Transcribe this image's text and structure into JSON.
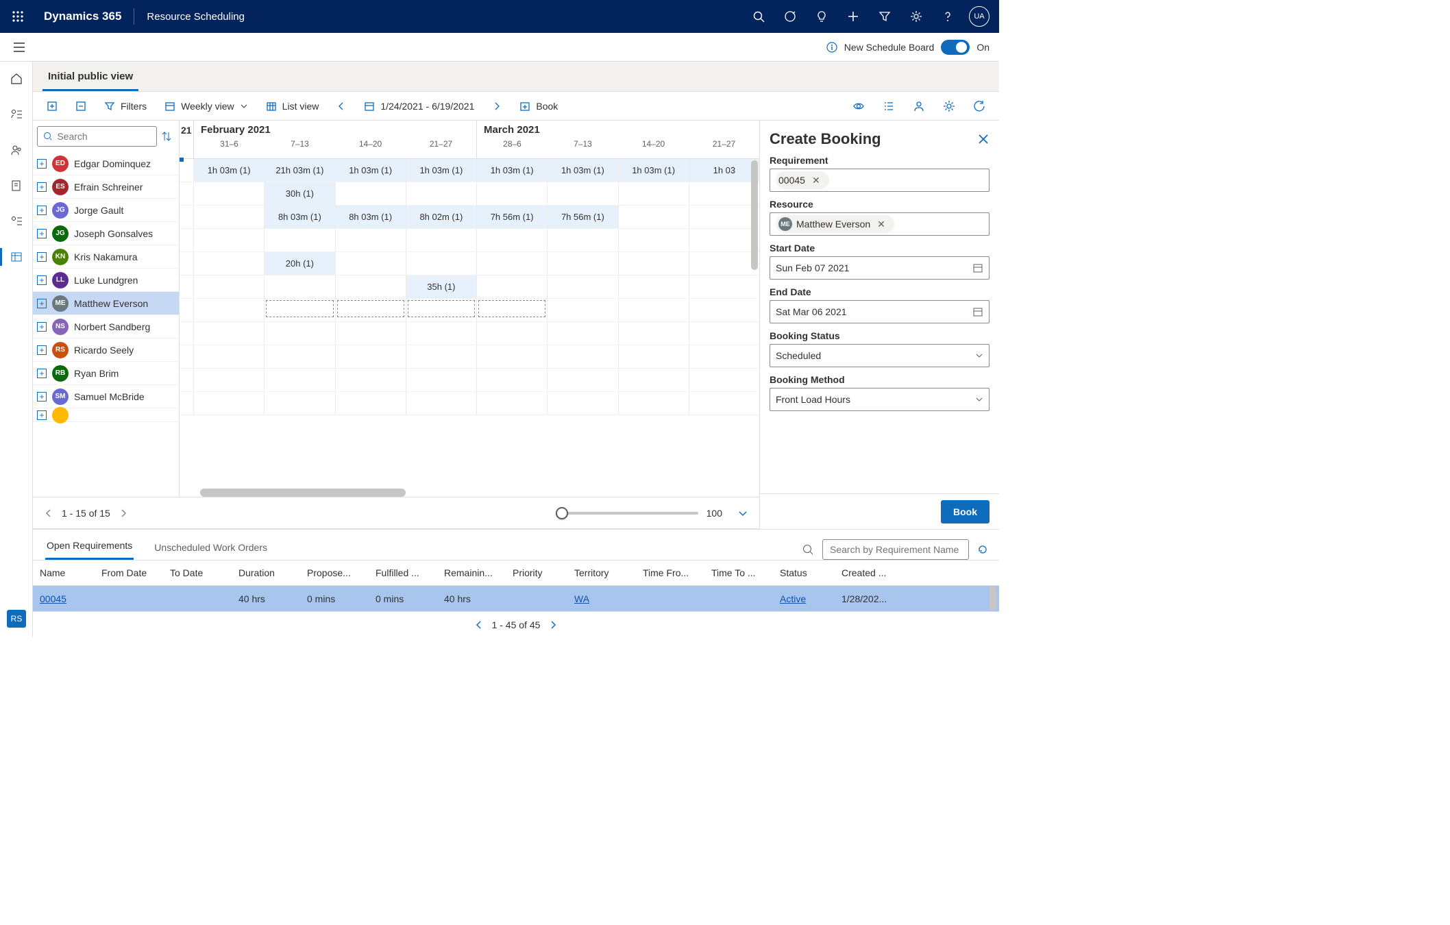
{
  "topbar": {
    "brand": "Dynamics 365",
    "app": "Resource Scheduling",
    "avatar": "UA",
    "icons": [
      "search-icon",
      "target-icon",
      "lightbulb-icon",
      "plus-icon",
      "filter-icon",
      "settings-icon",
      "help-icon"
    ]
  },
  "secondary": {
    "new_board": "New Schedule Board",
    "toggle_state": "On"
  },
  "tabs": {
    "active": "Initial public view"
  },
  "toolbar": {
    "filters": "Filters",
    "viewmode": "Weekly view",
    "listview": "List view",
    "daterange": "1/24/2021 - 6/19/2021",
    "book": "Book"
  },
  "search": {
    "placeholder": "Search"
  },
  "resources": [
    {
      "initials": "ED",
      "name": "Edgar Dominquez",
      "color": "#d13438"
    },
    {
      "initials": "ES",
      "name": "Efrain Schreiner",
      "color": "#a4262c"
    },
    {
      "initials": "JG",
      "name": "Jorge Gault",
      "color": "#6b69d6"
    },
    {
      "initials": "JG",
      "name": "Joseph Gonsalves",
      "color": "#0b6a0b"
    },
    {
      "initials": "KN",
      "name": "Kris Nakamura",
      "color": "#498205"
    },
    {
      "initials": "LL",
      "name": "Luke Lundgren",
      "color": "#5c2d91"
    },
    {
      "initials": "ME",
      "name": "Matthew Everson",
      "color": "#69797e"
    },
    {
      "initials": "NS",
      "name": "Norbert Sandberg",
      "color": "#8764b8"
    },
    {
      "initials": "RS",
      "name": "Ricardo Seely",
      "color": "#ca5010"
    },
    {
      "initials": "RB",
      "name": "Ryan Brim",
      "color": "#0b6a0b"
    },
    {
      "initials": "SM",
      "name": "Samuel McBride",
      "color": "#6b69d6"
    }
  ],
  "selected_resource_index": 6,
  "calendar": {
    "year_stub": "21",
    "months": [
      {
        "title": "February 2021",
        "weeks": [
          "31–6",
          "7–13",
          "14–20",
          "21–27"
        ]
      },
      {
        "title": "March 2021",
        "weeks": [
          "28–6",
          "7–13",
          "14–20",
          "21–27"
        ]
      }
    ],
    "rows": [
      {
        "cells": [
          "1h 03m (1)",
          "21h 03m (1)",
          "1h 03m (1)",
          "1h 03m (1)",
          "1h 03m (1)",
          "1h 03m (1)",
          "1h 03m (1)",
          "1h 03"
        ],
        "booked": [
          0,
          1,
          2,
          3,
          4,
          5,
          6,
          7
        ]
      },
      {
        "cells": [
          "",
          "30h (1)",
          "",
          "",
          "",
          "",
          "",
          ""
        ],
        "booked": [
          1
        ]
      },
      {
        "cells": [
          "",
          "8h 03m (1)",
          "8h 03m (1)",
          "8h 02m (1)",
          "7h 56m (1)",
          "7h 56m (1)",
          "",
          ""
        ],
        "booked": [
          1,
          2,
          3,
          4,
          5
        ]
      },
      {
        "cells": [
          "",
          "",
          "",
          "",
          "",
          "",
          "",
          ""
        ],
        "booked": []
      },
      {
        "cells": [
          "",
          "20h (1)",
          "",
          "",
          "",
          "",
          "",
          ""
        ],
        "booked": [
          1
        ]
      },
      {
        "cells": [
          "",
          "",
          "",
          "35h (1)",
          "",
          "",
          "",
          ""
        ],
        "booked": [
          3
        ]
      },
      {
        "cells": [
          "",
          "",
          "",
          "",
          "",
          "",
          "",
          ""
        ],
        "booked": [],
        "selected": [
          1,
          2,
          3,
          4
        ]
      },
      {
        "cells": [
          "",
          "",
          "",
          "",
          "",
          "",
          "",
          ""
        ],
        "booked": []
      },
      {
        "cells": [
          "",
          "",
          "",
          "",
          "",
          "",
          "",
          ""
        ],
        "booked": []
      },
      {
        "cells": [
          "",
          "",
          "",
          "",
          "",
          "",
          "",
          ""
        ],
        "booked": []
      },
      {
        "cells": [
          "",
          "",
          "",
          "",
          "",
          "",
          "",
          ""
        ],
        "booked": []
      }
    ]
  },
  "pagination": {
    "label": "1 - 15 of 15",
    "slider_value": "100"
  },
  "bottom": {
    "tabs": [
      "Open Requirements",
      "Unscheduled Work Orders"
    ],
    "active_tab": 0,
    "search_placeholder": "Search by Requirement Name",
    "columns": [
      "Name",
      "From Date",
      "To Date",
      "Duration",
      "Propose...",
      "Fulfilled ...",
      "Remainin...",
      "Priority",
      "Territory",
      "Time Fro...",
      "Time To ...",
      "Status",
      "Created ..."
    ],
    "row": {
      "Name": "00045",
      "From Date": "",
      "To Date": "",
      "Duration": "40 hrs",
      "Propose": "0 mins",
      "Fulfilled": "0 mins",
      "Remaining": "40 hrs",
      "Priority": "",
      "Territory": "WA",
      "Time From": "",
      "Time To": "",
      "Status": "Active",
      "Created": "1/28/202..."
    },
    "pager": "1 - 45 of 45"
  },
  "right_panel": {
    "title": "Create Booking",
    "field_requirement_label": "Requirement",
    "requirement_value": "00045",
    "field_resource_label": "Resource",
    "resource_chip": {
      "initials": "ME",
      "name": "Matthew Everson",
      "color": "#69797e"
    },
    "field_start_label": "Start Date",
    "start_value": "Sun Feb 07 2021",
    "field_end_label": "End Date",
    "end_value": "Sat Mar 06 2021",
    "field_status_label": "Booking Status",
    "status_value": "Scheduled",
    "field_method_label": "Booking Method",
    "method_value": "Front Load Hours",
    "book_button": "Book"
  },
  "rs_sidebar": "RS"
}
